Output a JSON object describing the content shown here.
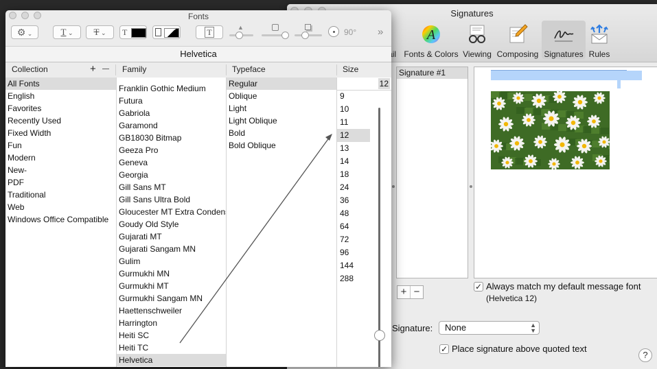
{
  "signatures_window": {
    "title": "Signatures",
    "toolbar": [
      {
        "label": "ail",
        "icon": "mail-icon"
      },
      {
        "label": "Fonts & Colors",
        "icon": "fonts-colors-icon"
      },
      {
        "label": "Viewing",
        "icon": "viewing-icon"
      },
      {
        "label": "Composing",
        "icon": "composing-icon"
      },
      {
        "label": "Signatures",
        "icon": "signatures-icon",
        "selected": true
      },
      {
        "label": "Rules",
        "icon": "rules-icon"
      }
    ],
    "signature_list": [
      "Signature #1"
    ],
    "editor_image": "daisies-photo",
    "add_label": "+",
    "remove_label": "−",
    "always_match_label": "Always match my default message font",
    "always_match_checked": true,
    "font_hint": "(Helvetica 12)",
    "signature_select_label": "Signature:",
    "signature_select_value": "None",
    "place_above_label": "Place signature above quoted text",
    "place_above_checked": true,
    "help_label": "?"
  },
  "fonts_panel": {
    "title": "Fonts",
    "toolbar": {
      "action_icon": "gear-icon",
      "underline_icon": "underline-icon",
      "strikethrough_icon": "strikethrough-icon",
      "text_color_icon": "text-color-icon",
      "document_color_icon": "document-color-icon",
      "text_shadow_icon": "text-shadow-icon",
      "shadow_opacity_icon": "shadow-opacity-icon",
      "shadow_blur_icon": "shadow-blur-icon",
      "shadow_offset_icon": "shadow-offset-icon",
      "angle_value": "90°",
      "more_icon": "chevron-double-right-icon"
    },
    "current_font": "Helvetica",
    "headers": {
      "collection": "Collection",
      "family": "Family",
      "typeface": "Typeface",
      "size": "Size",
      "add": "+",
      "remove": "—"
    },
    "collections": [
      "All Fonts",
      "English",
      "Favorites",
      "Recently Used",
      "Fixed Width",
      "Fun",
      "Modern",
      "New-",
      "PDF",
      "Traditional",
      "Web",
      "Windows Office Compatible"
    ],
    "selected_collection": "All Fonts",
    "families": [
      "Franklin Gothic Medium",
      "Futura",
      "Gabriola",
      "Garamond",
      "GB18030 Bitmap",
      "Geeza Pro",
      "Geneva",
      "Georgia",
      "Gill Sans MT",
      "Gill Sans Ultra Bold",
      "Gloucester MT Extra Condensed",
      "Goudy Old Style",
      "Gujarati MT",
      "Gujarati Sangam MN",
      "Gulim",
      "Gurmukhi MN",
      "Gurmukhi MT",
      "Gurmukhi Sangam MN",
      "Haettenschweiler",
      "Harrington",
      "Heiti SC",
      "Heiti TC",
      "Helvetica"
    ],
    "selected_family": "Helvetica",
    "typefaces": [
      "Regular",
      "Oblique",
      "Light",
      "Light Oblique",
      "Bold",
      "Bold Oblique"
    ],
    "selected_typeface": "Regular",
    "size_value": "12",
    "sizes": [
      "9",
      "10",
      "11",
      "12",
      "13",
      "14",
      "18",
      "24",
      "36",
      "48",
      "64",
      "72",
      "96",
      "144",
      "288"
    ],
    "selected_size": "12"
  }
}
